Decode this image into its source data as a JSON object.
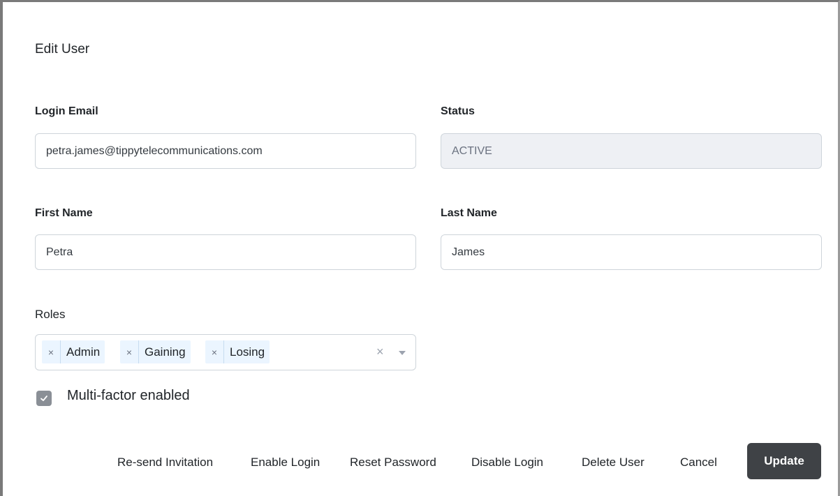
{
  "dialog": {
    "title": "Edit User"
  },
  "form": {
    "login_email": {
      "label": "Login Email",
      "value": "petra.james@tippytelecommunications.com"
    },
    "status": {
      "label": "Status",
      "value": "ACTIVE"
    },
    "first_name": {
      "label": "First Name",
      "value": "Petra"
    },
    "last_name": {
      "label": "Last Name",
      "value": "James"
    },
    "roles": {
      "label": "Roles",
      "selected": [
        "Admin",
        "Gaining",
        "Losing"
      ],
      "remove_glyph": "×",
      "clear_glyph": "×"
    },
    "mfa": {
      "label": "Multi-factor enabled",
      "checked": true
    }
  },
  "actions": {
    "resend_invitation": "Re-send Invitation",
    "enable_login": "Enable Login",
    "reset_password": "Reset Password",
    "disable_login": "Disable Login",
    "delete_user": "Delete User",
    "cancel": "Cancel",
    "update": "Update"
  },
  "colors": {
    "primary_button": "#3f4246",
    "chip_background": "#ebf5ff",
    "readonly_background": "#eef0f4",
    "checkbox": "#8a8f96"
  },
  "icons": {
    "checkbox_check": "check-icon",
    "dropdown": "chevron-down-icon",
    "clear": "close-icon"
  }
}
